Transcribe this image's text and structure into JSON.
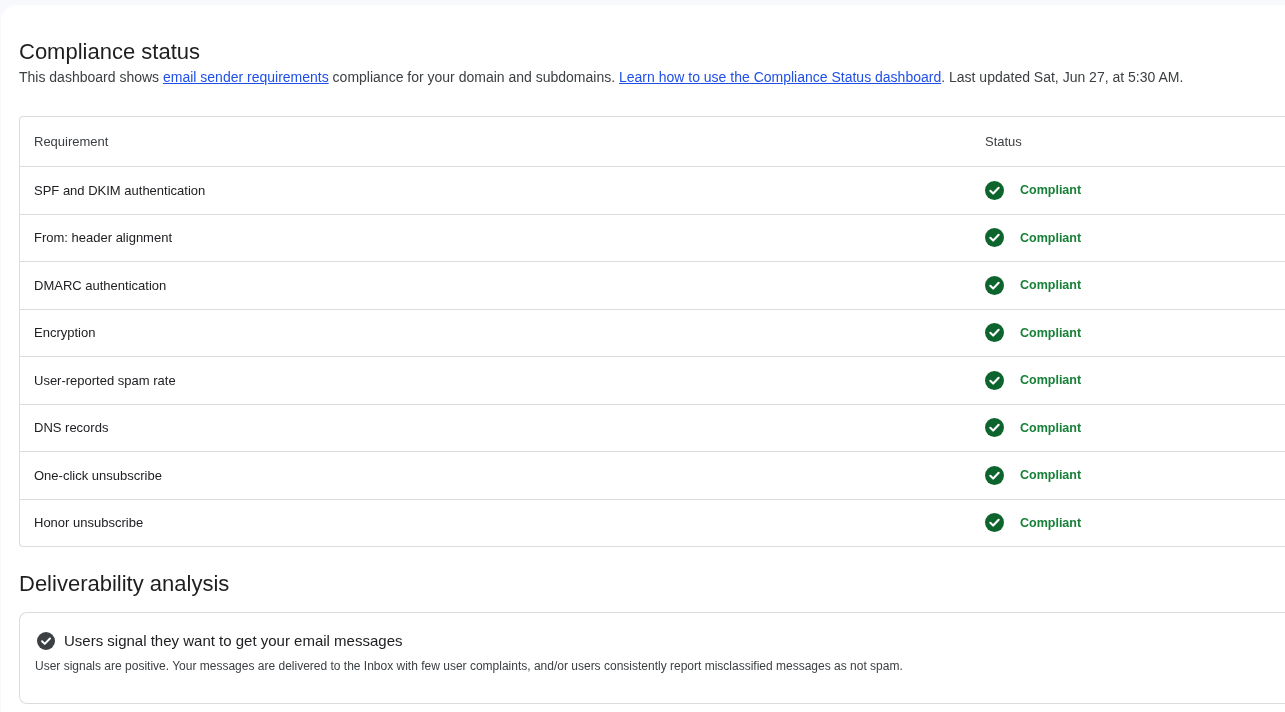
{
  "compliance": {
    "title": "Compliance status",
    "description": [
      {
        "kind": "text",
        "text": "This dashboard shows "
      },
      {
        "kind": "link",
        "text": "email sender requirements"
      },
      {
        "kind": "text",
        "text": " compliance for your domain and subdomains. "
      },
      {
        "kind": "link",
        "text": "Learn how to use the Compliance Status dashboard"
      },
      {
        "kind": "text",
        "text": ". Last updated Sat, Jun 27, at 5:30 AM."
      }
    ],
    "table": {
      "columns": [
        "Requirement",
        "Status"
      ],
      "rows": [
        {
          "requirement": "SPF and DKIM authentication",
          "status": {
            "kind": "compliant",
            "label": "Compliant"
          }
        },
        {
          "requirement": "From: header alignment",
          "status": {
            "kind": "compliant",
            "label": "Compliant"
          }
        },
        {
          "requirement": "DMARC authentication",
          "status": {
            "kind": "compliant",
            "label": "Compliant"
          }
        },
        {
          "requirement": "Encryption",
          "status": {
            "kind": "compliant",
            "label": "Compliant"
          }
        },
        {
          "requirement": "User-reported spam rate",
          "status": {
            "kind": "compliant",
            "label": "Compliant"
          }
        },
        {
          "requirement": "DNS records",
          "status": {
            "kind": "compliant",
            "label": "Compliant"
          }
        },
        {
          "requirement": "One-click unsubscribe",
          "status": {
            "kind": "compliant",
            "label": "Compliant"
          }
        },
        {
          "requirement": "Honor unsubscribe",
          "status": {
            "kind": "compliant",
            "label": "Compliant"
          }
        }
      ]
    }
  },
  "deliverability": {
    "title": "Deliverability analysis",
    "cards": [
      {
        "kind": "positive",
        "title": "Users signal they want to get your email messages",
        "description": "User signals are positive. Your messages are delivered to the Inbox with few user complaints, and/or users consistently report misclassified messages as not spam."
      }
    ]
  }
}
